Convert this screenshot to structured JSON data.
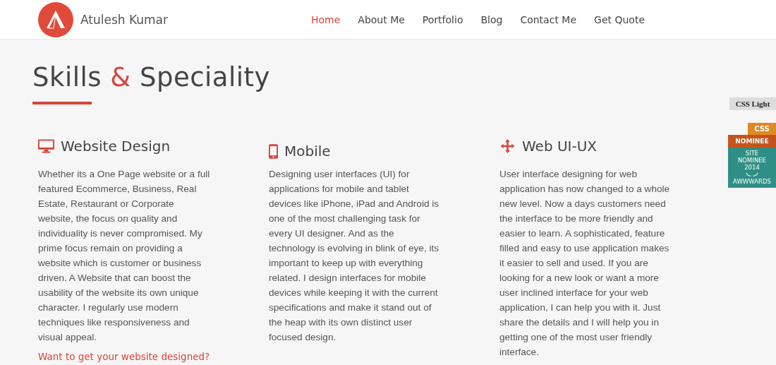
{
  "brand": {
    "name": "Atulesh Kumar"
  },
  "nav": [
    {
      "label": "Home",
      "selected": true
    },
    {
      "label": "About Me",
      "selected": false
    },
    {
      "label": "Portfolio",
      "selected": false
    },
    {
      "label": "Blog",
      "selected": false
    },
    {
      "label": "Contact Me",
      "selected": false
    },
    {
      "label": "Get Quote",
      "selected": false
    }
  ],
  "heading": [
    {
      "text": "Skills",
      "accent": false
    },
    {
      "text": "&",
      "accent": true
    },
    {
      "text": "Speciality",
      "accent": false
    }
  ],
  "skills": [
    {
      "kind": "desktop",
      "title": "Website Design",
      "text": "Whether its a One Page website or a full featured Ecommerce, Business, Real Estate, Restaurant or Corporate website, the focus on quality and individuality is never compromised. My prime focus remain on providing a website which is customer or business driven. A Website that can boost the usability of the website its own unique character. I regularly use modern techniques like responsiveness and visual appeal.",
      "link": "Want to get your website designed?"
    },
    {
      "kind": "mobile",
      "title": "Mobile",
      "text": "Designing user interfaces (UI) for applications for mobile and tablet devices like iPhone, iPad and Android is one of the most challenging task for every UI designer. And as the technology is evolving in blink of eye, its important to keep up with everything related. I design interfaces for mobile devices while keeping it with the current specifications and make it stand out of the heap with its own distinct user focused design."
    },
    {
      "kind": "move",
      "title": "Web UI-UX",
      "text": "User interface designing for web application has now changed to a whole new level. Now a days customers need the interface to be more friendly and easier to learn. A sophisticated, feature filled and easy to use application makes it easier to sell and used. If you are looking for a new look or want a more user inclined interface for your web application, I can help you with it. Just share the details and I will help you in getting one of the most user friendly interface."
    }
  ],
  "badges": {
    "ribbon": "CSS Light",
    "css": "CSS",
    "nominee": "NOMINEE",
    "award_lines": [
      "SITE",
      "NOMINEE",
      "2014"
    ],
    "award_name": "AWWWARDS"
  }
}
